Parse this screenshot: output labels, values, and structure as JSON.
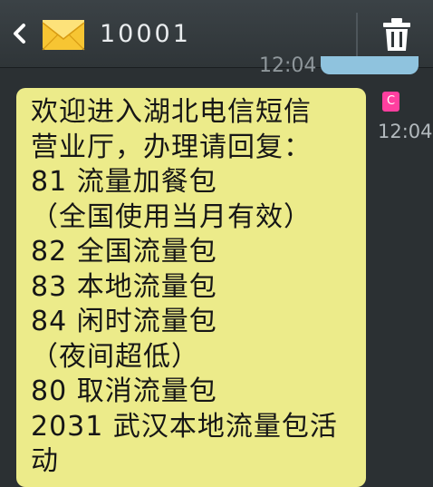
{
  "header": {
    "back_icon": "back-arrow-icon",
    "avatar_icon": "envelope-icon",
    "title": "10001",
    "delete_icon": "trash-icon"
  },
  "previous_message": {
    "time": "12:04"
  },
  "message": {
    "sim_badge": "C",
    "time": "12:04",
    "lines": [
      "欢迎进入湖北电信短信",
      "营业厅，办理请回复：",
      "81 流量加餐包",
      "（全国使用当月有效）",
      "82 全国流量包",
      "83 本地流量包",
      "84 闲时流量包",
      "（夜间超低）",
      "80 取消流量包",
      "2031 武汉本地流量包活",
      "动"
    ]
  },
  "colors": {
    "background": "#2b3033",
    "bubble": "#eceb8a",
    "sent_bubble": "#8fc3de",
    "sim_badge": "#ff3f9f"
  }
}
